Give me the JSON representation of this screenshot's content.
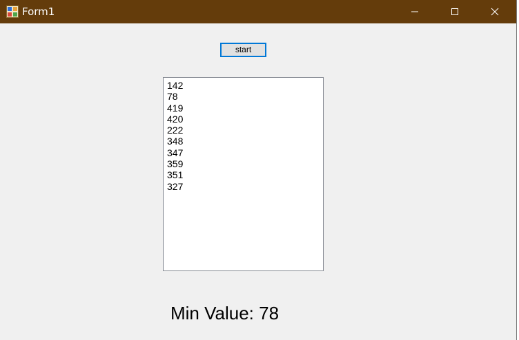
{
  "window": {
    "title": "Form1",
    "titlebar_color": "#643c0b",
    "icons": {
      "app": "app-icon",
      "minimize": "minimize-icon",
      "maximize": "maximize-icon",
      "close": "close-icon"
    }
  },
  "form": {
    "start_label": "start",
    "list_items": [
      "142",
      "78",
      "419",
      "420",
      "222",
      "348",
      "347",
      "359",
      "351",
      "327"
    ],
    "min_label": "Min Value:",
    "min_value": "78"
  },
  "colors": {
    "focus_border": "#0078d7",
    "form_background": "#f0f0f0"
  }
}
